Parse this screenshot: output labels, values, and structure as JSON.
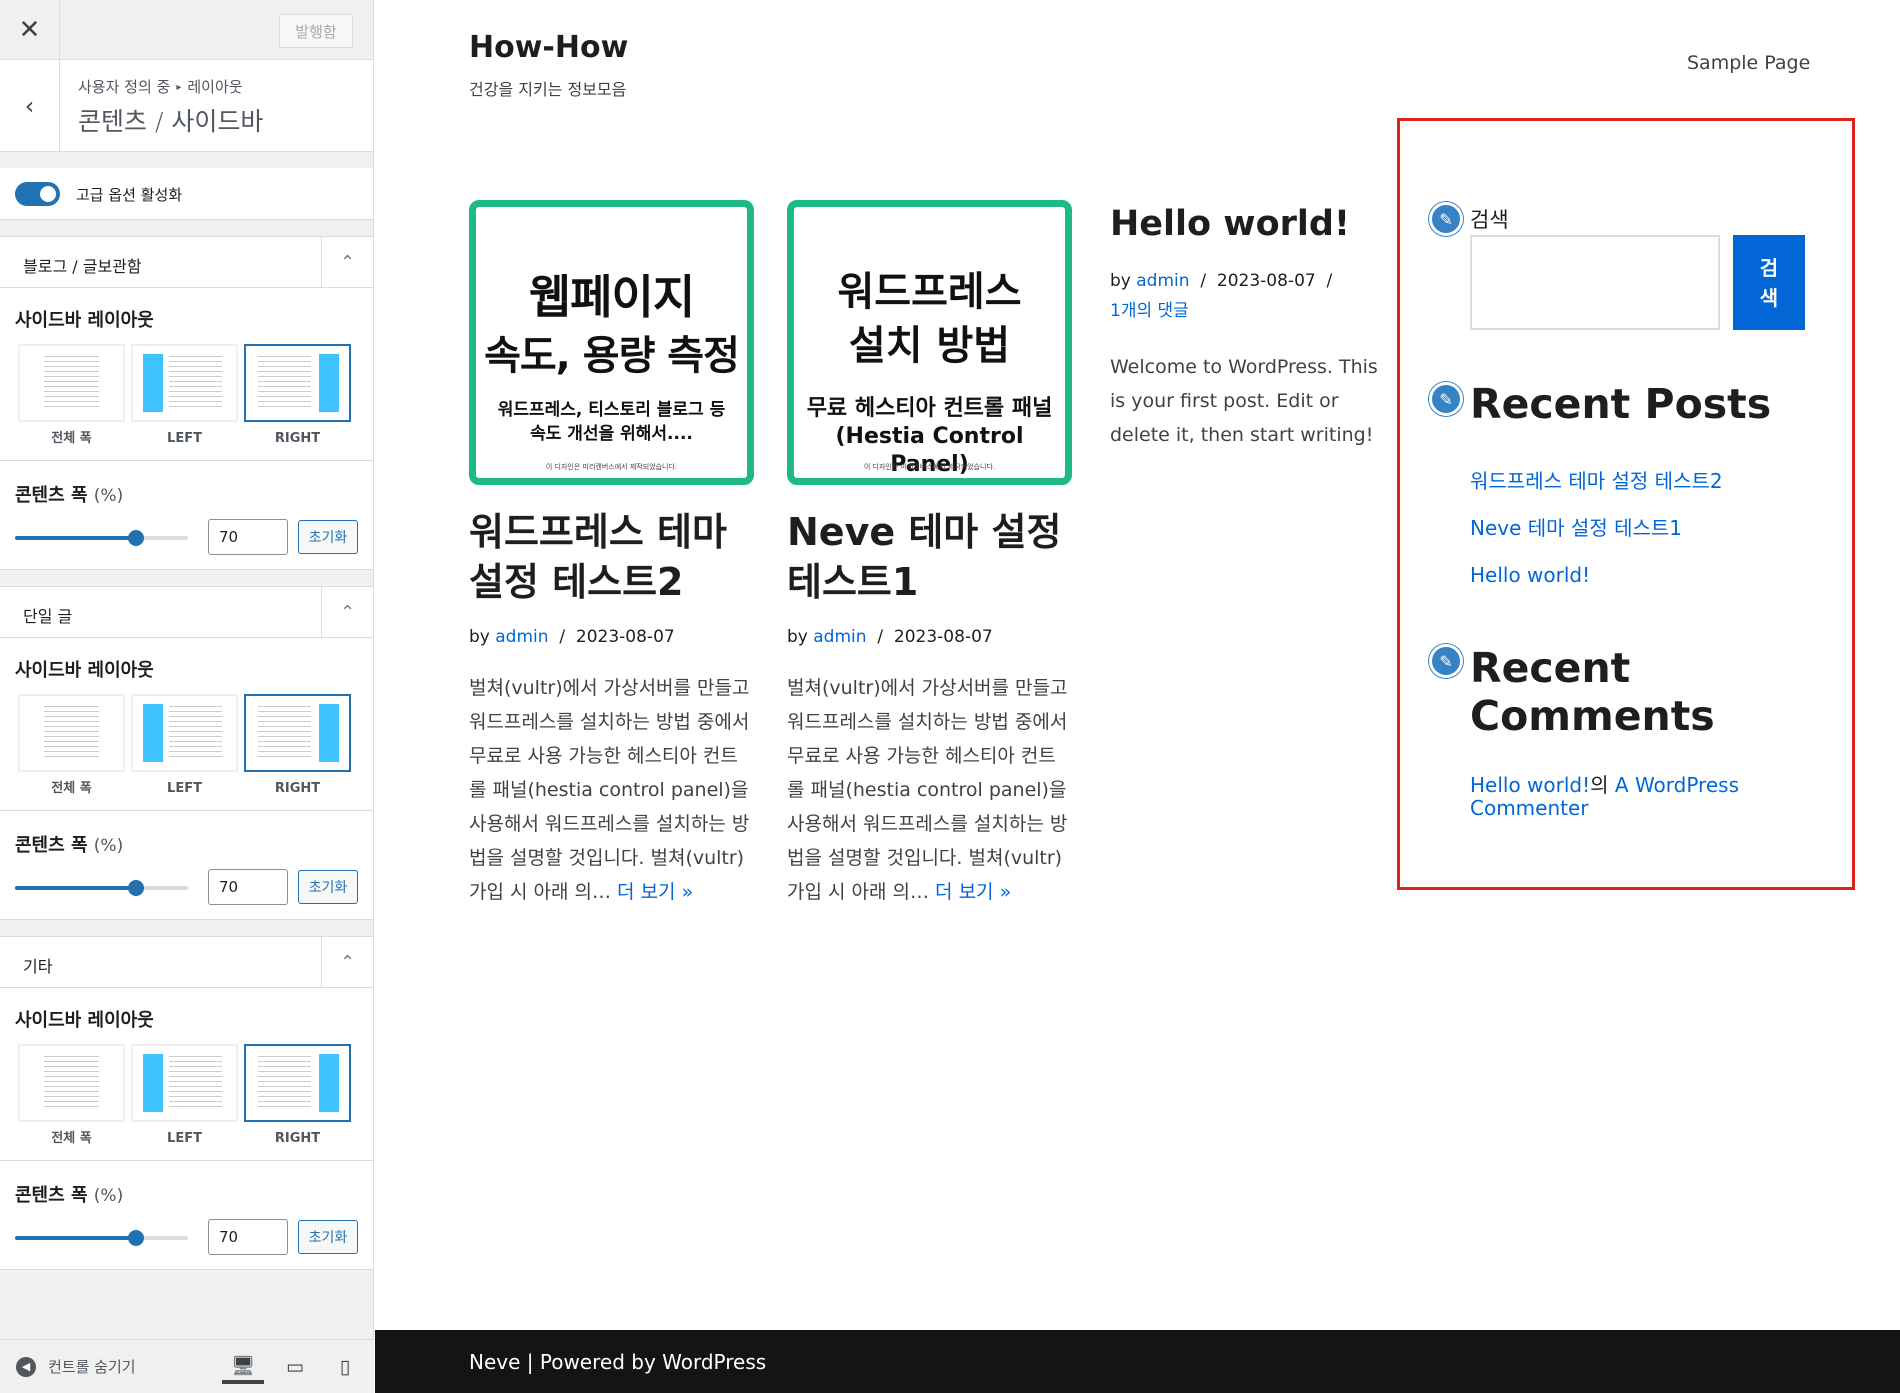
{
  "customizer": {
    "close_icon": "✕",
    "publish_label": "발행함",
    "back_icon": "‹",
    "breadcrumb_parent": "사용자 정의 중",
    "breadcrumb_section": "레이아웃",
    "section_title": "콘텐츠 / 사이드바",
    "advanced_toggle_label": "고급 옵션 활성화",
    "advanced_toggle_on": true,
    "sections": [
      {
        "title": "블로그 / 글보관함",
        "sidebar_layout_label": "사이드바 레이아웃",
        "layout_options": [
          "전체 폭",
          "LEFT",
          "RIGHT"
        ],
        "selected_layout": "RIGHT",
        "content_width_label": "콘텐츠 폭",
        "content_width_unit": "(%)",
        "content_width_value": "70",
        "reset_label": "초기화"
      },
      {
        "title": "단일 글",
        "sidebar_layout_label": "사이드바 레이아웃",
        "layout_options": [
          "전체 폭",
          "LEFT",
          "RIGHT"
        ],
        "selected_layout": "RIGHT",
        "content_width_label": "콘텐츠 폭",
        "content_width_unit": "(%)",
        "content_width_value": "70",
        "reset_label": "초기화"
      },
      {
        "title": "기타",
        "sidebar_layout_label": "사이드바 레이아웃",
        "layout_options": [
          "전체 폭",
          "LEFT",
          "RIGHT"
        ],
        "selected_layout": "RIGHT",
        "content_width_label": "콘텐츠 폭",
        "content_width_unit": "(%)",
        "content_width_value": "70",
        "reset_label": "초기화"
      }
    ],
    "footer": {
      "hide_controls_label": "컨트롤 숨기기",
      "devices": [
        "desktop-icon",
        "tablet-icon",
        "mobile-icon"
      ],
      "active_device": "desktop-icon"
    }
  },
  "site": {
    "title": "How-How",
    "tagline": "건강을 지키는 정보모음",
    "nav": [
      "Sample Page"
    ],
    "posts": [
      {
        "thumb_line1": "웹페이지",
        "thumb_line2": "속도, 용량 측정",
        "thumb_sub1": "워드프레스, 티스토리 블로그 등",
        "thumb_sub2": "속도 개선을 위해서....",
        "thumb_tiny": "이 디자인은 미리캔버스에서 제작되었습니다.",
        "title_l1": "워드프레스 테마",
        "title_l2": "설정 테스트2",
        "by": "by",
        "author": "admin",
        "sep": "/",
        "date": "2023-08-07",
        "excerpt": "벌쳐(vultr)에서 가상서버를 만들고 워드프레스를 설치하는 방법 중에서 무료로 사용 가능한 헤스티아 컨트롤 패널(hestia control panel)을 사용해서 워드프레스를 설치하는 방법을 설명할 것입니다. 벌쳐(vultr) 가입 시 아래 의…",
        "more": "더 보기 »"
      },
      {
        "thumb_line1": "워드프레스",
        "thumb_line2": "설치 방법",
        "thumb_sub1": "무료 헤스티아 컨트롤 패널",
        "thumb_sub2": "(Hestia Control Panel)",
        "thumb_tiny": "이 디자인은 미리캔버스에서 제작되었습니다.",
        "title_l1": "Neve 테마 설정",
        "title_l2": "테스트1",
        "by": "by",
        "author": "admin",
        "sep": "/",
        "date": "2023-08-07",
        "excerpt": "벌쳐(vultr)에서 가상서버를 만들고 워드프레스를 설치하는 방법 중에서 무료로 사용 가능한 헤스티아 컨트롤 패널(hestia control panel)을 사용해서 워드프레스를 설치하는 방법을 설명할 것입니다. 벌쳐(vultr) 가입 시 아래 의…",
        "more": "더 보기 »"
      },
      {
        "title": "Hello world!",
        "by": "by",
        "author": "admin",
        "sep": "/",
        "date": "2023-08-07",
        "comments": "1개의 댓글",
        "excerpt": "Welcome to WordPress. This is your first post. Edit or delete it, then start writing!"
      }
    ],
    "sidebar": {
      "search_label": "검색",
      "search_value": "",
      "search_button": "검색",
      "recent_posts_title": "Recent Posts",
      "recent_posts": [
        "워드프레스 테마 설정 테스트2",
        "Neve 테마 설정 테스트1",
        "Hello world!"
      ],
      "recent_comments_title": "Recent Comments",
      "recent_comment_post": "Hello world!",
      "recent_comment_of": "의",
      "recent_comment_author": "A WordPress Commenter"
    },
    "footer_text": "Neve | Powered by WordPress"
  },
  "colors": {
    "accent": "#2271b1",
    "link": "#0366d6",
    "highlight_border": "#e0201b",
    "thumb_border": "#1fb889",
    "footer_bg": "#141414"
  }
}
